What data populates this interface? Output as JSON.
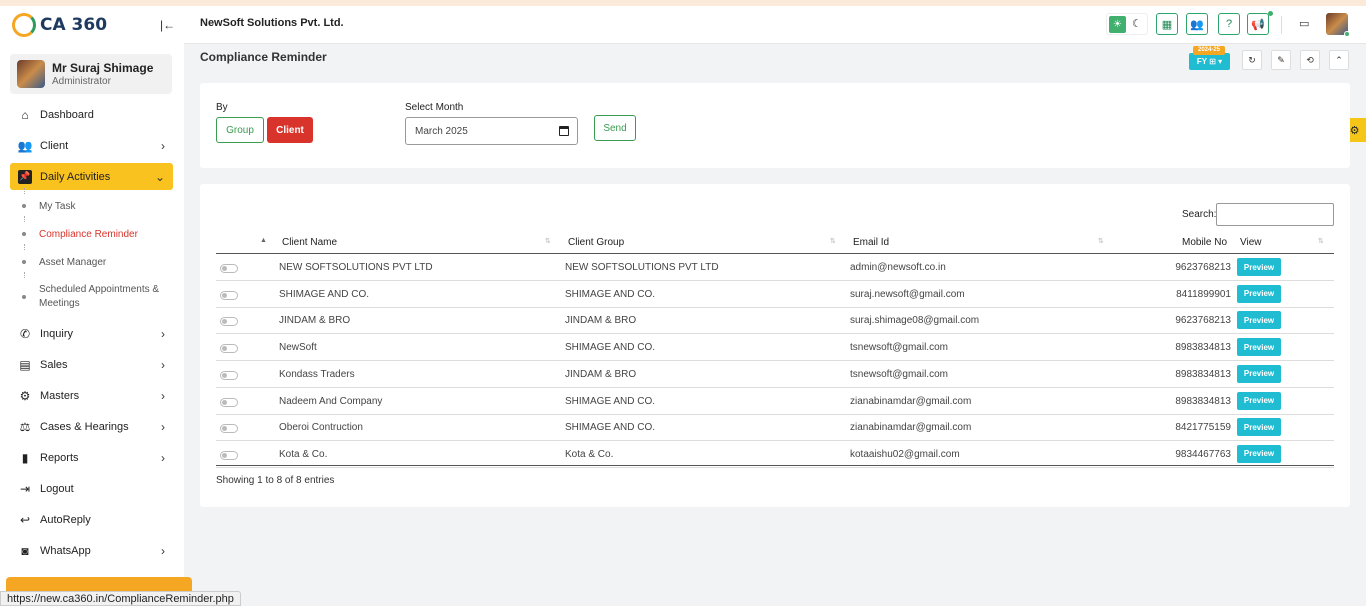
{
  "brand": {
    "name": "CA 360"
  },
  "user": {
    "name": "Mr Suraj Shimage",
    "role": "Administrator"
  },
  "sidebar": {
    "items": [
      {
        "label": "Dashboard",
        "icon": "home-icon",
        "glyph": "⌂",
        "chev": ""
      },
      {
        "label": "Client",
        "icon": "users-icon",
        "glyph": "👥",
        "chev": "›"
      },
      {
        "label": "Daily Activities",
        "icon": "pin-icon",
        "glyph": "📌",
        "chev": "⌄"
      }
    ],
    "sub_items": [
      {
        "label": "My Task"
      },
      {
        "label": "Compliance Reminder"
      },
      {
        "label": "Asset Manager"
      },
      {
        "label": "Scheduled Appointments & Meetings"
      }
    ],
    "items_after": [
      {
        "label": "Inquiry",
        "icon": "phone-icon",
        "glyph": "✆",
        "chev": "›"
      },
      {
        "label": "Sales",
        "icon": "sales-icon",
        "glyph": "▤",
        "chev": "›"
      },
      {
        "label": "Masters",
        "icon": "cogs-icon",
        "glyph": "⚙",
        "chev": "›"
      },
      {
        "label": "Cases & Hearings",
        "icon": "scale-icon",
        "glyph": "⚖",
        "chev": "›"
      },
      {
        "label": "Reports",
        "icon": "report-icon",
        "glyph": "▮",
        "chev": "›"
      },
      {
        "label": "Logout",
        "icon": "logout-icon",
        "glyph": "⇥",
        "chev": ""
      },
      {
        "label": "AutoReply",
        "icon": "reply-icon",
        "glyph": "↩",
        "chev": ""
      },
      {
        "label": "WhatsApp",
        "icon": "whatsapp-icon",
        "glyph": "◙",
        "chev": "›"
      }
    ]
  },
  "status_url": "https://new.ca360.in/ComplianceReminder.php",
  "header": {
    "company": "NewSoft Solutions Pvt. Ltd.",
    "fy_year": "2024-25",
    "fy_label": "FY ⊞ ▾"
  },
  "page": {
    "title": "Compliance Reminder"
  },
  "filter": {
    "by_label": "By",
    "group_label": "Group",
    "client_label": "Client",
    "month_label": "Select Month",
    "month_value": "March 2025",
    "send_label": "Send"
  },
  "table": {
    "search_label": "Search:",
    "columns": {
      "client_name": "Client Name",
      "client_group": "Client Group",
      "email": "Email Id",
      "mobile": "Mobile No",
      "view": "View"
    },
    "preview_label": "Preview",
    "rows": [
      {
        "client_name": "NEW SOFTSOLUTIONS PVT LTD",
        "client_group": "NEW SOFTSOLUTIONS PVT LTD",
        "email": "admin@newsoft.co.in",
        "mobile": "9623768213"
      },
      {
        "client_name": "SHIMAGE AND CO.",
        "client_group": "SHIMAGE AND CO.",
        "email": "suraj.newsoft@gmail.com",
        "mobile": "8411899901"
      },
      {
        "client_name": "JINDAM & BRO",
        "client_group": "JINDAM & BRO",
        "email": "suraj.shimage08@gmail.com",
        "mobile": "9623768213"
      },
      {
        "client_name": "NewSoft",
        "client_group": "SHIMAGE AND CO.",
        "email": "tsnewsoft@gmail.com",
        "mobile": "8983834813"
      },
      {
        "client_name": "Kondass Traders",
        "client_group": "JINDAM & BRO",
        "email": "tsnewsoft@gmail.com",
        "mobile": "8983834813"
      },
      {
        "client_name": "Nadeem And Company",
        "client_group": "SHIMAGE AND CO.",
        "email": "zianabinamdar@gmail.com",
        "mobile": "8983834813"
      },
      {
        "client_name": "Oberoi Contruction",
        "client_group": "SHIMAGE AND CO.",
        "email": "zianabinamdar@gmail.com",
        "mobile": "8421775159"
      },
      {
        "client_name": "Kota & Co.",
        "client_group": "Kota & Co.",
        "email": "kotaaishu02@gmail.com",
        "mobile": "9834467763"
      }
    ],
    "entries_info": "Showing 1 to 8 of 8 entries"
  },
  "colors": {
    "accent_yellow": "#f9c21f",
    "danger": "#d9342b",
    "success": "#3a9c4f",
    "info": "#1fbcd2"
  }
}
